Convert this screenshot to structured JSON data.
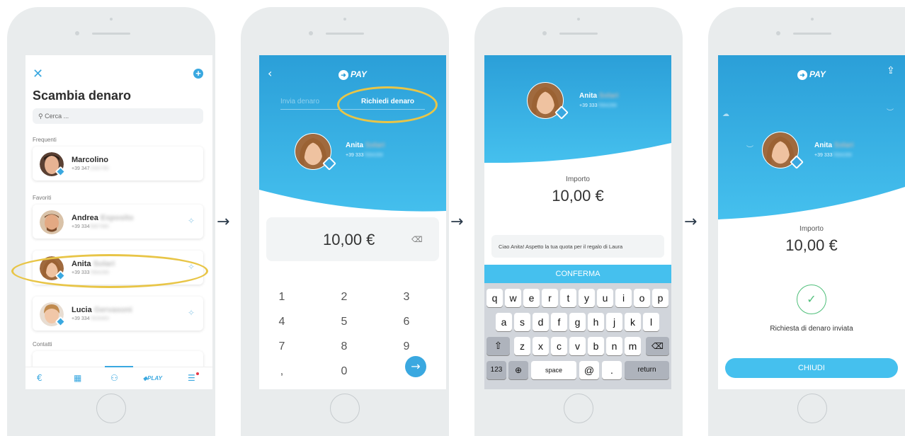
{
  "screen1": {
    "title": "Scambia denaro",
    "search_placeholder": "Cerca ...",
    "sections": {
      "frequent": "Frequenti",
      "favorites": "Favoriti",
      "contacts": "Contatti"
    },
    "contacts": [
      {
        "first": "Marcolino",
        "last": "",
        "phone": "+39 347",
        "phone_hidden": "2345780"
      },
      {
        "first": "Andrea",
        "last": "Esposito",
        "phone": "+39 334",
        "phone_hidden": "5687990"
      },
      {
        "first": "Anita",
        "last": "Solari",
        "phone": "+39 333",
        "phone_hidden": "7894289"
      },
      {
        "first": "Lucia",
        "last": "Gervasoni",
        "phone": "+39 334",
        "phone_hidden": "7829463"
      }
    ],
    "tabbar": {
      "play_label": "PLAY"
    }
  },
  "screen2": {
    "brand": "PAY",
    "tab_send": "Invia denaro",
    "tab_request": "Richiedi denaro",
    "contact": {
      "first": "Anita",
      "last": "Solari",
      "phone": "+39 333",
      "phone_hidden": "7894289"
    },
    "amount": "10,00 €",
    "keys": [
      "1",
      "2",
      "3",
      "4",
      "5",
      "6",
      "7",
      "8",
      "9",
      ",",
      "0"
    ]
  },
  "screen3": {
    "contact": {
      "first": "Anita",
      "last": "Solari",
      "phone": "+39 333",
      "phone_hidden": "7894289"
    },
    "amount_label": "Importo",
    "amount": "10,00 €",
    "message": "Ciao Anita! Aspetto la tua quota per il regalo di Laura",
    "confirm": "CONFERMA",
    "keyboard": {
      "row1": [
        "q",
        "w",
        "e",
        "r",
        "t",
        "y",
        "u",
        "i",
        "o",
        "p"
      ],
      "row2": [
        "a",
        "s",
        "d",
        "f",
        "g",
        "h",
        "j",
        "k",
        "l"
      ],
      "row3": [
        "z",
        "x",
        "c",
        "v",
        "b",
        "n",
        "m"
      ],
      "num": "123",
      "space": "space",
      "at": "@",
      "dot": ".",
      "return": "return"
    }
  },
  "screen4": {
    "brand": "PAY",
    "contact": {
      "first": "Anita",
      "last": "Solari",
      "phone": "+39 333",
      "phone_hidden": "7894289"
    },
    "amount_label": "Importo",
    "amount": "10,00 €",
    "status": "Richiesta di denaro inviata",
    "close": "CHIUDI"
  },
  "colors": {
    "accent": "#3aa8e0",
    "highlight": "#e8c547",
    "success": "#4fbf7a"
  }
}
